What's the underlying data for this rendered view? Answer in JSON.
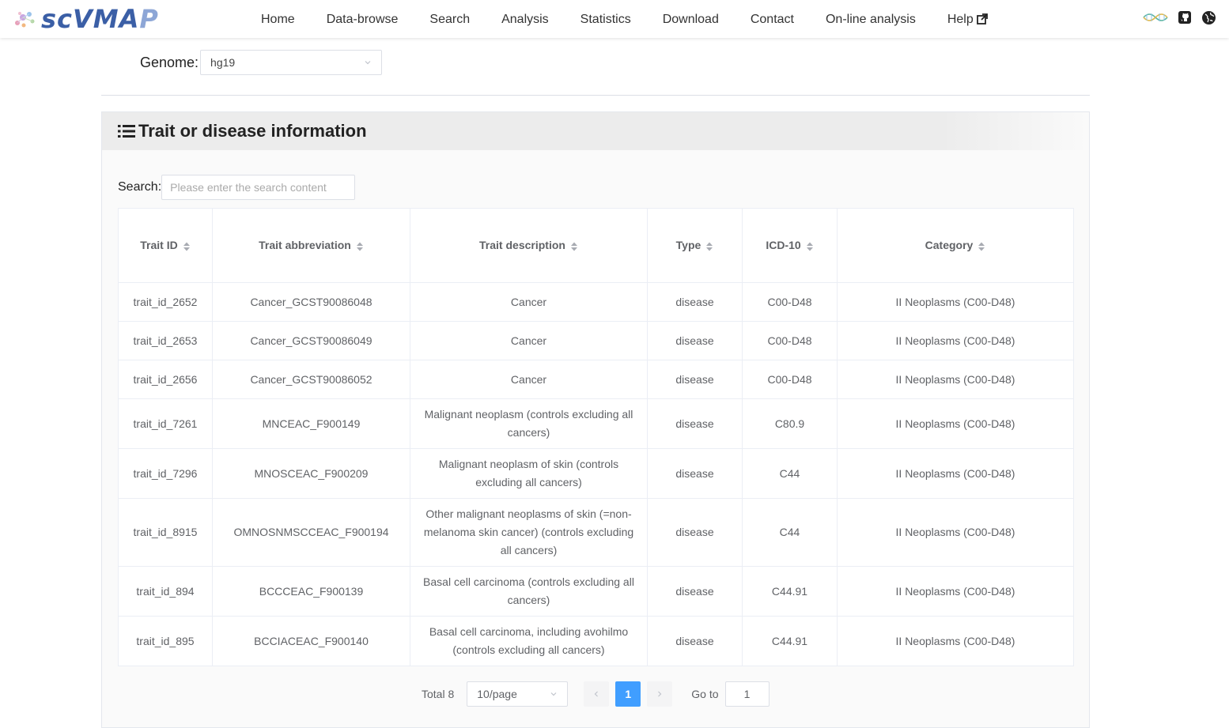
{
  "brand": {
    "logo_text_main": "scVMA",
    "logo_text_fade": "P"
  },
  "nav": {
    "items": [
      {
        "label": "Home"
      },
      {
        "label": "Data-browse"
      },
      {
        "label": "Search"
      },
      {
        "label": "Analysis"
      },
      {
        "label": "Statistics"
      },
      {
        "label": "Download"
      },
      {
        "label": "Contact"
      },
      {
        "label": "On-line analysis"
      },
      {
        "label": "Help"
      }
    ],
    "right_icons": [
      "dna-icon",
      "github-icon",
      "globe-icon"
    ]
  },
  "genome": {
    "label": "Genome:",
    "value": "hg19"
  },
  "panel": {
    "title": "Trait or disease information"
  },
  "search": {
    "label": "Search:",
    "placeholder": "Please enter the search content",
    "value": ""
  },
  "table": {
    "columns": [
      "Trait ID",
      "Trait abbreviation",
      "Trait description",
      "Type",
      "ICD-10",
      "Category"
    ],
    "rows": [
      [
        "trait_id_2652",
        "Cancer_GCST90086048",
        "Cancer",
        "disease",
        "C00-D48",
        "II Neoplasms (C00-D48)"
      ],
      [
        "trait_id_2653",
        "Cancer_GCST90086049",
        "Cancer",
        "disease",
        "C00-D48",
        "II Neoplasms (C00-D48)"
      ],
      [
        "trait_id_2656",
        "Cancer_GCST90086052",
        "Cancer",
        "disease",
        "C00-D48",
        "II Neoplasms (C00-D48)"
      ],
      [
        "trait_id_7261",
        "MNCEAC_F900149",
        "Malignant neoplasm (controls excluding all cancers)",
        "disease",
        "C80.9",
        "II Neoplasms (C00-D48)"
      ],
      [
        "trait_id_7296",
        "MNOSCEAC_F900209",
        "Malignant neoplasm of skin (controls excluding all cancers)",
        "disease",
        "C44",
        "II Neoplasms (C00-D48)"
      ],
      [
        "trait_id_8915",
        "OMNOSNMSCCEAC_F900194",
        "Other malignant neoplasms of skin (=non-melanoma skin cancer) (controls excluding all cancers)",
        "disease",
        "C44",
        "II Neoplasms (C00-D48)"
      ],
      [
        "trait_id_894",
        "BCCCEAC_F900139",
        "Basal cell carcinoma (controls excluding all cancers)",
        "disease",
        "C44.91",
        "II Neoplasms (C00-D48)"
      ],
      [
        "trait_id_895",
        "BCCIACEAC_F900140",
        "Basal cell carcinoma, including avohilmo (controls excluding all cancers)",
        "disease",
        "C44.91",
        "II Neoplasms (C00-D48)"
      ]
    ]
  },
  "pagination": {
    "total": "Total 8",
    "page_size": "10/page",
    "current_page": "1",
    "goto_label": "Go to",
    "goto_value": "1"
  },
  "colors": {
    "link": "#1f78d1",
    "active_page": "#409eff",
    "brand": "#3b5fa6"
  }
}
